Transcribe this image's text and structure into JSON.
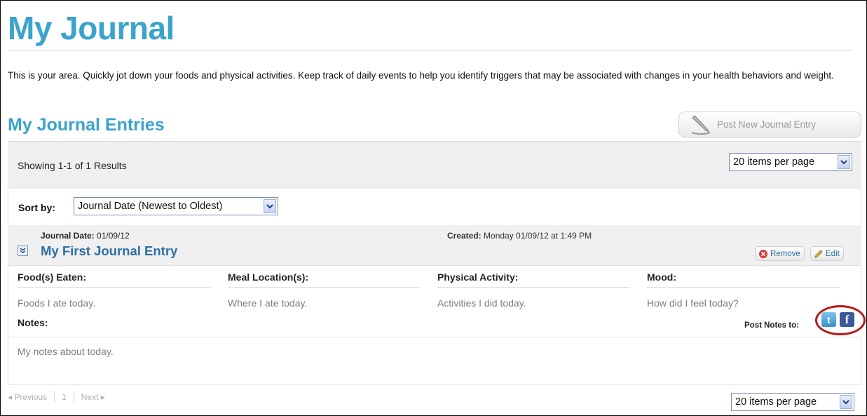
{
  "page": {
    "title": "My Journal",
    "intro": "This is your area. Quickly jot down your foods and physical activities. Keep track of daily events to help you identify triggers that may be associated with changes in your health behaviors and weight."
  },
  "entries_section": {
    "title": "My Journal Entries",
    "post_button_label": "Post New Journal Entry",
    "results_text": "Showing 1-1 of 1 Results",
    "per_page": "20 items per page",
    "sort_label": "Sort by:",
    "sort_value": "Journal Date (Newest to Oldest)"
  },
  "entry": {
    "journal_date_label": "Journal Date:",
    "journal_date": "01/09/12",
    "created_label": "Created:",
    "created_value": "Monday 01/09/12 at 1:49 PM",
    "title": "My First Journal Entry",
    "remove_label": "Remove",
    "edit_label": "Edit",
    "columns": [
      {
        "heading": "Food(s) Eaten:",
        "value": "Foods I ate today."
      },
      {
        "heading": "Meal Location(s):",
        "value": "Where I ate today."
      },
      {
        "heading": "Physical Activity:",
        "value": "Activities I did today."
      },
      {
        "heading": "Mood:",
        "value": "How did I feel today?"
      }
    ],
    "notes_label": "Notes:",
    "notes_value": "My notes about today.",
    "post_notes_label": "Post Notes to:",
    "social": {
      "twitter_glyph": "t",
      "facebook_glyph": "f"
    }
  },
  "pager": {
    "previous": "Previous",
    "page": "1",
    "next": "Next",
    "per_page": "20 items per page"
  },
  "colors": {
    "title_blue": "#3ba3cc",
    "link_blue": "#2f6fa3",
    "highlight_red": "#b41a1a"
  }
}
